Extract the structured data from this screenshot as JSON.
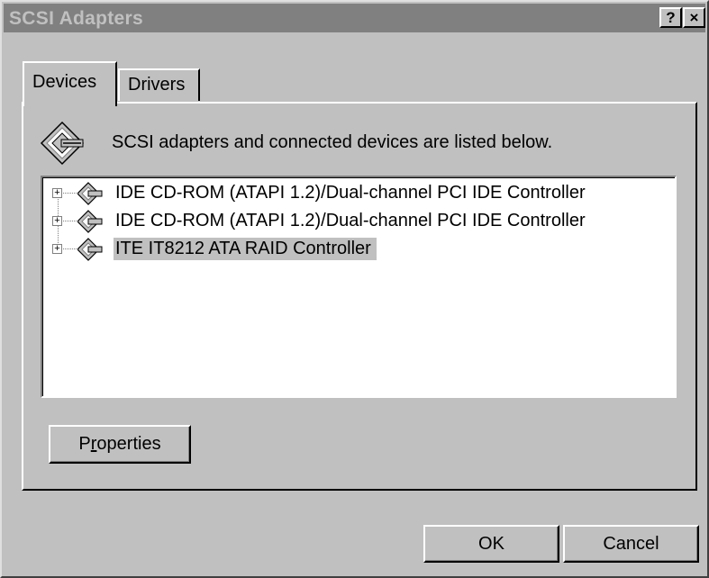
{
  "window": {
    "title": "SCSI Adapters",
    "help_button": "?",
    "close_button": "×"
  },
  "tabs": [
    {
      "label": "Devices",
      "active": true
    },
    {
      "label": "Drivers",
      "active": false
    }
  ],
  "header": {
    "icon": "scsi-adapter-icon",
    "text": "SCSI adapters and connected devices are listed below."
  },
  "device_list": {
    "items": [
      {
        "label": "IDE CD-ROM (ATAPI 1.2)/Dual-channel PCI IDE Controller",
        "icon": "scsi-adapter-icon",
        "expander": "+",
        "selected": false
      },
      {
        "label": "IDE CD-ROM (ATAPI 1.2)/Dual-channel PCI IDE Controller",
        "icon": "scsi-adapter-icon",
        "expander": "+",
        "selected": false
      },
      {
        "label": "ITE IT8212 ATA RAID Controller",
        "icon": "scsi-adapter-icon",
        "expander": "+",
        "selected": true
      }
    ]
  },
  "buttons": {
    "properties": {
      "label_pre": "P",
      "label_mnemonic": "r",
      "label_post": "operties"
    },
    "ok": "OK",
    "cancel": "Cancel"
  },
  "colors": {
    "face": "#c0c0c0",
    "titlebar_inactive": "#808080",
    "selection": "#c0c0c0",
    "list_bg": "#ffffff"
  }
}
